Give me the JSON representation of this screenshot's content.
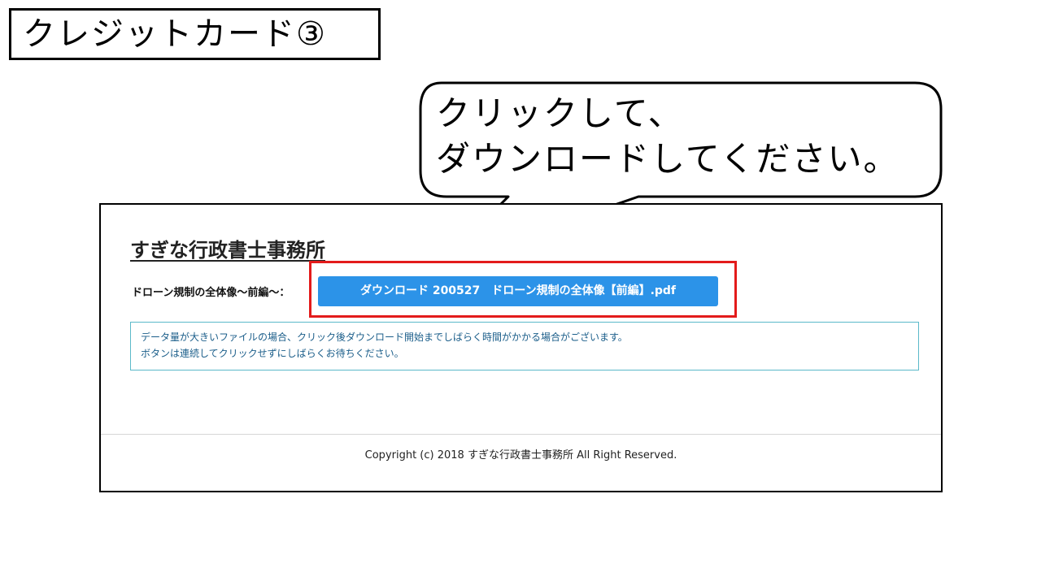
{
  "slide": {
    "title": "クレジットカード③"
  },
  "callout": {
    "line1": "クリックして、",
    "line2": "ダウンロードしてください。"
  },
  "page": {
    "site_title": "すぎな行政書士事務所",
    "file_label": "ドローン規制の全体像～前編～：",
    "download_button_label": "ダウンロード 200527　ドローン規制の全体像【前編】.pdf",
    "notice_line1": "データ量が大きいファイルの場合、クリック後ダウンロード開始までしばらく時間がかかる場合がございます。",
    "notice_line2": "ボタンは連続してクリックせずにしばらくお待ちください。",
    "copyright": "Copyright (c) 2018 すぎな行政書士事務所 All Right Reserved."
  },
  "colors": {
    "button": "#2c93e8",
    "highlight": "#e31b1b",
    "notice_border": "#5bb9c9",
    "notice_text": "#1b5e8a"
  }
}
